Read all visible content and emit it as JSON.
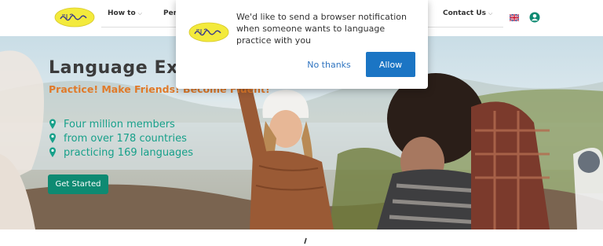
{
  "logo": {
    "icon": "site-logo"
  },
  "nav": {
    "items": [
      {
        "label": "How to",
        "has_dropdown": true
      },
      {
        "label": "Pen",
        "has_dropdown": false
      },
      {
        "label": "Contact Us",
        "has_dropdown": true
      }
    ],
    "chevron": "⌵",
    "language_flag": "uk-flag-icon",
    "account_icon": "user-circle-icon"
  },
  "hero": {
    "title": "Language Ex",
    "tagline": "Practice! Make Friends! Become Fluent!",
    "stats": [
      "Four million members",
      "from over 178 countries",
      "practicing 169 languages"
    ],
    "stat_icon": "map-pin-icon",
    "cta_label": "Get Started"
  },
  "notification_prompt": {
    "message": "We'd like to send a browser notification when someone wants to language practice with you",
    "decline_label": "No thanks",
    "accept_label": "Allow",
    "icon": "site-logo"
  },
  "colors": {
    "brand_teal": "#0e8a72",
    "stat_text": "#17a08a",
    "tagline_orange": "#e07a2a",
    "allow_blue": "#1b75c4",
    "link_blue": "#2f74c0",
    "logo_yellow": "#f3ea3c"
  }
}
